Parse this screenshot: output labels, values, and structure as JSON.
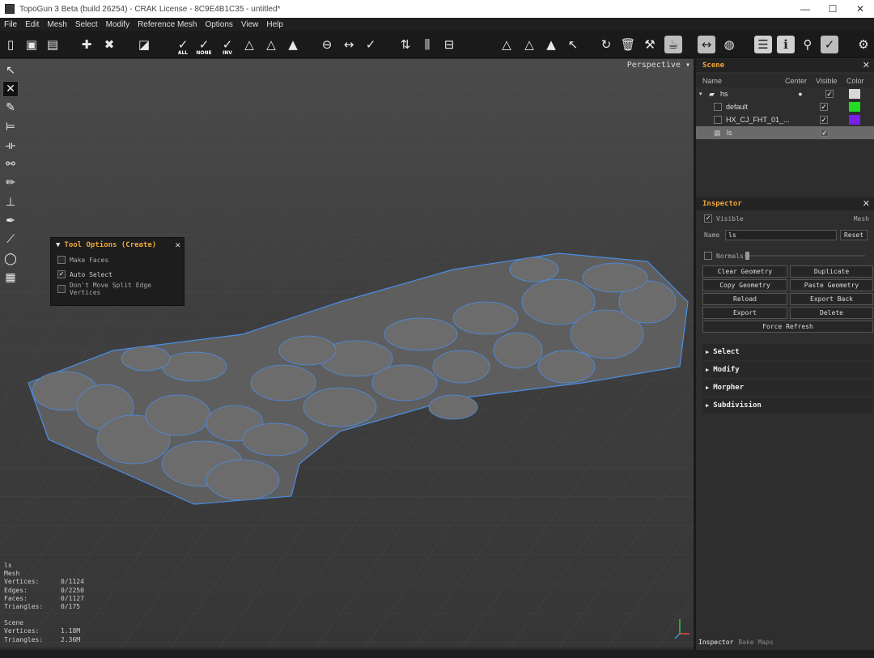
{
  "window": {
    "title": "TopoGun 3 Beta (build 26254) - CRAK License - 8C9E4B1C35 - untitled*",
    "controls": [
      "—",
      "☐",
      "✕"
    ]
  },
  "menu": [
    "File",
    "Edit",
    "Mesh",
    "Select",
    "Modify",
    "Reference Mesh",
    "Options",
    "View",
    "Help"
  ],
  "toolbar": {
    "select_all_label": "ALL",
    "select_none_label": "NONE",
    "select_inv_label": "INV"
  },
  "viewport": {
    "camera_label": "Perspective",
    "tool_options": {
      "title": "Tool Options (Create)",
      "close": "✕",
      "options": [
        {
          "label": "Make Faces",
          "checked": false
        },
        {
          "label": "Auto Select",
          "checked": true
        },
        {
          "label": "Don't Move Split Edge Vertices",
          "checked": false
        }
      ]
    },
    "stats": {
      "object_name": "ls",
      "object_type": "Mesh",
      "mesh_rows": [
        {
          "label": "Vertices:",
          "value": "0/1124"
        },
        {
          "label": "Edges:",
          "value": "0/2250"
        },
        {
          "label": "Faces:",
          "value": "0/1127"
        },
        {
          "label": "Triangles:",
          "value": "0/175"
        }
      ],
      "scene_label": "Scene",
      "scene_rows": [
        {
          "label": "Vertices:",
          "value": "1.18M"
        },
        {
          "label": "Triangles:",
          "value": "2.36M"
        }
      ]
    }
  },
  "scene_panel": {
    "title": "Scene",
    "close": "✕",
    "columns": {
      "name": "Name",
      "center": "Center",
      "visible": "Visible",
      "color": "Color"
    },
    "items": [
      {
        "name": "hs",
        "visible": true,
        "color": "#d8d8d8"
      },
      {
        "name": "default",
        "visible": true,
        "color": "#22dd22"
      },
      {
        "name": "HX_CJ_FHT_01_...",
        "visible": true,
        "color": "#7a1ee8"
      },
      {
        "name": "ls",
        "visible": true,
        "color": ""
      }
    ]
  },
  "inspector": {
    "title": "Inspector",
    "close": "✕",
    "visible_label": "Visible",
    "type_label": "Mesh",
    "name_label": "Name",
    "name_value": "ls",
    "reset_label": "Reset",
    "normals_label": "Normals",
    "buttons": [
      "Clear Geometry",
      "Duplicate",
      "Copy Geometry",
      "Paste Geometry",
      "Reload",
      "Export Back",
      "Export",
      "Delete"
    ],
    "force_refresh": "Force Refresh",
    "sections": [
      "Select",
      "Modify",
      "Morpher",
      "Subdivision"
    ]
  },
  "bottom_tabs": [
    "Inspector",
    "Bake Maps"
  ],
  "colors": {
    "accent": "#f0a63a",
    "wire": "#4a8ee8"
  }
}
